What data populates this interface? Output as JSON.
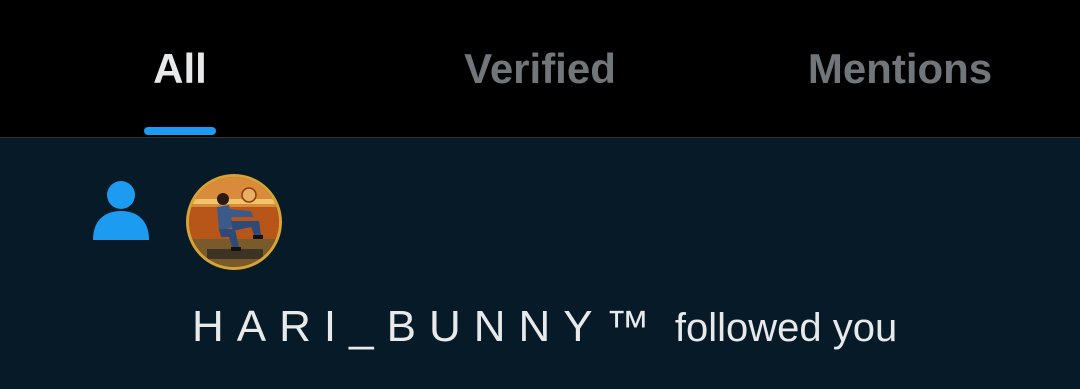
{
  "tabs": [
    {
      "label": "All",
      "active": true
    },
    {
      "label": "Verified",
      "active": false
    },
    {
      "label": "Mentions",
      "active": false
    }
  ],
  "colors": {
    "background": "#000000",
    "notification_background": "#061a27",
    "accent": "#1d9bf0",
    "text_primary": "#e7e9ea",
    "text_secondary": "#71767b",
    "avatar_ring": "#d4a437"
  },
  "notification": {
    "icon": "person-icon",
    "avatar_icon": "avatar",
    "username": "HARI_BUNNY™",
    "action_text": "followed you"
  }
}
